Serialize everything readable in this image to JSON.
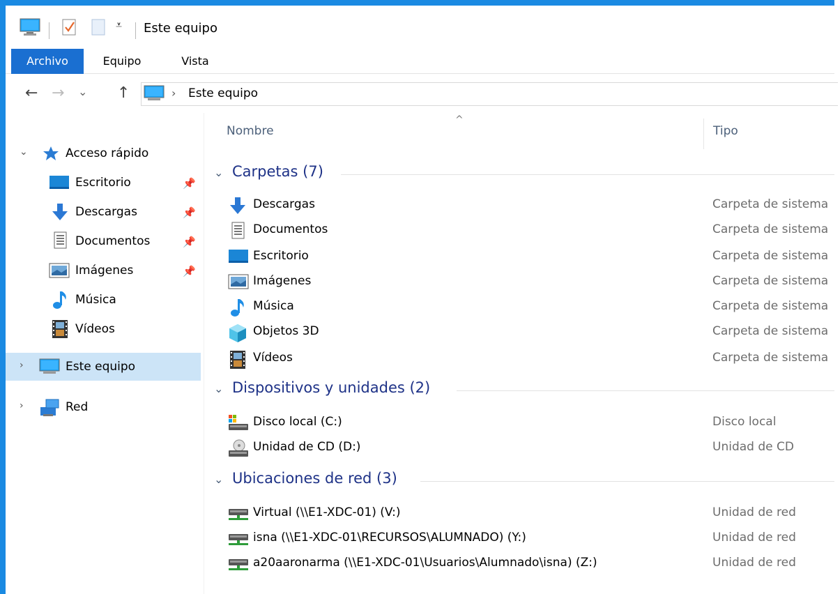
{
  "window": {
    "title": "Este equipo",
    "accent": "#1a8ae2"
  },
  "ribbon": {
    "tabs": [
      {
        "label": "Archivo",
        "active": true
      },
      {
        "label": "Equipo"
      },
      {
        "label": "Vista"
      }
    ]
  },
  "nav": {
    "back": "←",
    "forward": "→",
    "recent": "⌄",
    "up": "↑",
    "path_sep": "›",
    "path": "Este equipo"
  },
  "sidebar": {
    "quick_access": {
      "label": "Acceso rápido",
      "icon": "star-icon",
      "items": [
        {
          "label": "Escritorio",
          "icon": "desktop-icon",
          "pinned": true
        },
        {
          "label": "Descargas",
          "icon": "download-icon",
          "pinned": true
        },
        {
          "label": "Documentos",
          "icon": "document-icon",
          "pinned": true
        },
        {
          "label": "Imágenes",
          "icon": "pictures-icon",
          "pinned": true
        },
        {
          "label": "Música",
          "icon": "music-icon",
          "pinned": false
        },
        {
          "label": "Vídeos",
          "icon": "video-icon",
          "pinned": false
        }
      ]
    },
    "this_pc": {
      "label": "Este equipo",
      "selected": true
    },
    "network": {
      "label": "Red"
    }
  },
  "columns": {
    "name": "Nombre",
    "type": "Tipo"
  },
  "groups": [
    {
      "title": "Carpetas (7)",
      "items": [
        {
          "name": "Descargas",
          "type": "Carpeta de sistema",
          "icon": "download-icon"
        },
        {
          "name": "Documentos",
          "type": "Carpeta de sistema",
          "icon": "document-icon"
        },
        {
          "name": "Escritorio",
          "type": "Carpeta de sistema",
          "icon": "desktop-icon"
        },
        {
          "name": "Imágenes",
          "type": "Carpeta de sistema",
          "icon": "pictures-icon"
        },
        {
          "name": "Música",
          "type": "Carpeta de sistema",
          "icon": "music-icon"
        },
        {
          "name": "Objetos 3D",
          "type": "Carpeta de sistema",
          "icon": "objects3d-icon"
        },
        {
          "name": "Vídeos",
          "type": "Carpeta de sistema",
          "icon": "video-icon"
        }
      ]
    },
    {
      "title": "Dispositivos y unidades (2)",
      "items": [
        {
          "name": "Disco local (C:)",
          "type": "Disco local",
          "icon": "local-disk-icon"
        },
        {
          "name": "Unidad de CD (D:)",
          "type": "Unidad de CD",
          "icon": "cd-drive-icon"
        }
      ]
    },
    {
      "title": "Ubicaciones de red (3)",
      "items": [
        {
          "name": "Virtual (\\\\E1-XDC-01) (V:)",
          "type": "Unidad de red",
          "icon": "network-drive-icon"
        },
        {
          "name": "isna (\\\\E1-XDC-01\\RECURSOS\\ALUMNADO) (Y:)",
          "type": "Unidad de red",
          "icon": "network-drive-icon"
        },
        {
          "name": "a20aaronarma (\\\\E1-XDC-01\\Usuarios\\Alumnado\\isna) (Z:)",
          "type": "Unidad de red",
          "icon": "network-drive-icon"
        }
      ]
    }
  ]
}
